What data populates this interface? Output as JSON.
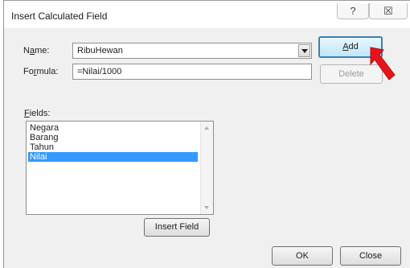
{
  "dialog": {
    "title": "Insert Calculated Field",
    "help_glyph": "?",
    "close_glyph": "☒"
  },
  "name": {
    "label_pre": "N",
    "label_accel": "a",
    "label_post": "me:",
    "value": "RibuHewan"
  },
  "formula": {
    "label_pre": "Fo",
    "label_accel": "r",
    "label_post": "mula:",
    "value": "=Nilai/1000"
  },
  "fields": {
    "label_accel": "F",
    "label_post": "ields:",
    "items": [
      "Negara",
      "Barang",
      "Tahun",
      "Nilai"
    ],
    "selected": "Nilai"
  },
  "buttons": {
    "add_pre": "",
    "add_accel": "A",
    "add_post": "dd",
    "delete": "Delete",
    "insert_field": "Insert Field",
    "ok": "OK",
    "close": "Close"
  },
  "colors": {
    "selection": "#3399ff",
    "arrow": "#e5141b",
    "default_button_border": "#3c7fb1"
  }
}
